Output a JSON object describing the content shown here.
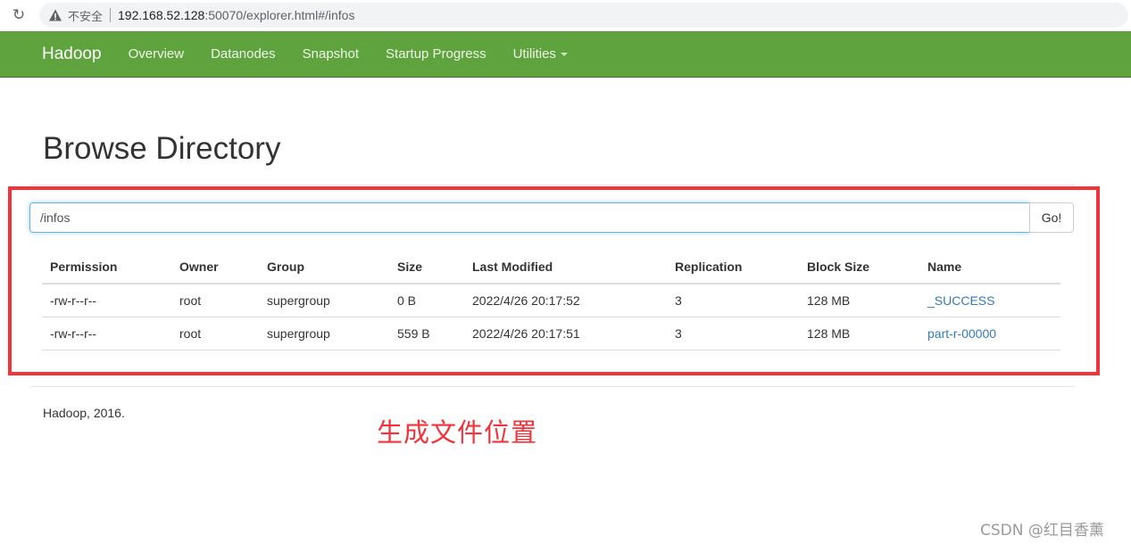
{
  "browser": {
    "security_label": "不安全",
    "url_host": "192.168.52.128",
    "url_rest": ":50070/explorer.html#/infos",
    "icons": {
      "reload": "reload-icon",
      "warning": "warning-icon"
    }
  },
  "navbar": {
    "brand": "Hadoop",
    "color": "#5fa33e",
    "items": [
      {
        "label": "Overview"
      },
      {
        "label": "Datanodes"
      },
      {
        "label": "Snapshot"
      },
      {
        "label": "Startup Progress"
      },
      {
        "label": "Utilities"
      }
    ]
  },
  "main": {
    "title": "Browse Directory",
    "path_value": "/infos",
    "go_label": "Go!",
    "table": {
      "headers": [
        "Permission",
        "Owner",
        "Group",
        "Size",
        "Last Modified",
        "Replication",
        "Block Size",
        "Name"
      ],
      "rows": [
        [
          "-rw-r--r--",
          "root",
          "supergroup",
          "0 B",
          "2022/4/26 20:17:52",
          "3",
          "128 MB",
          "_SUCCESS"
        ],
        [
          "-rw-r--r--",
          "root",
          "supergroup",
          "559 B",
          "2022/4/26 20:17:51",
          "3",
          "128 MB",
          "part-r-00000"
        ]
      ]
    }
  },
  "footer": {
    "text": "Hadoop, 2016."
  },
  "annotation": {
    "text": "生成文件位置",
    "color": "#f2333a"
  },
  "watermark": {
    "text": "CSDN @红目香薰"
  }
}
